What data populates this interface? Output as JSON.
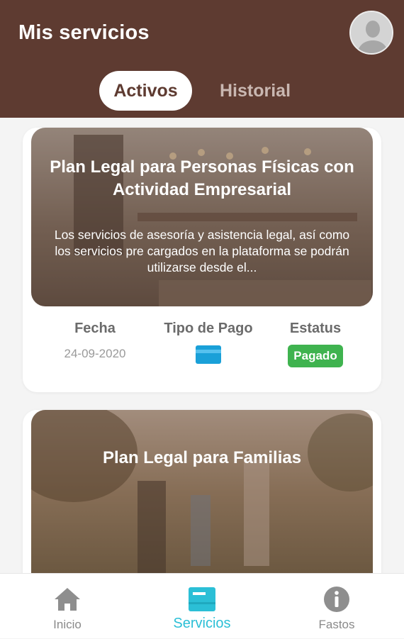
{
  "header": {
    "title": "Mis servicios",
    "avatar_icon": "user-avatar-icon",
    "tabs": [
      {
        "label": "Activos",
        "active": true
      },
      {
        "label": "Historial",
        "active": false
      }
    ],
    "background_color": "#5e3b31"
  },
  "cards": [
    {
      "title": "Plan Legal para Personas Físicas con Actividad Empresarial",
      "description": "Los servicios de asesoría y asistencia legal, así como los servicios pre cargados en la plataforma se podrán utilizarse desde el...",
      "fecha_label": "Fecha",
      "fecha_value": "24-09-2020",
      "pago_label": "Tipo de Pago",
      "pago_icon": "credit-card-icon",
      "estatus_label": "Estatus",
      "estatus_value": "Pagado",
      "estatus_color": "#3fb34f"
    },
    {
      "title": "Plan Legal para Familias"
    }
  ],
  "bottom_nav": [
    {
      "label": "Inicio",
      "icon": "home-icon",
      "active": false
    },
    {
      "label": "Servicios",
      "icon": "services-icon",
      "active": true
    },
    {
      "label": "Fastos",
      "icon": "info-icon",
      "active": false
    }
  ],
  "accent_color": "#2bbfd6"
}
